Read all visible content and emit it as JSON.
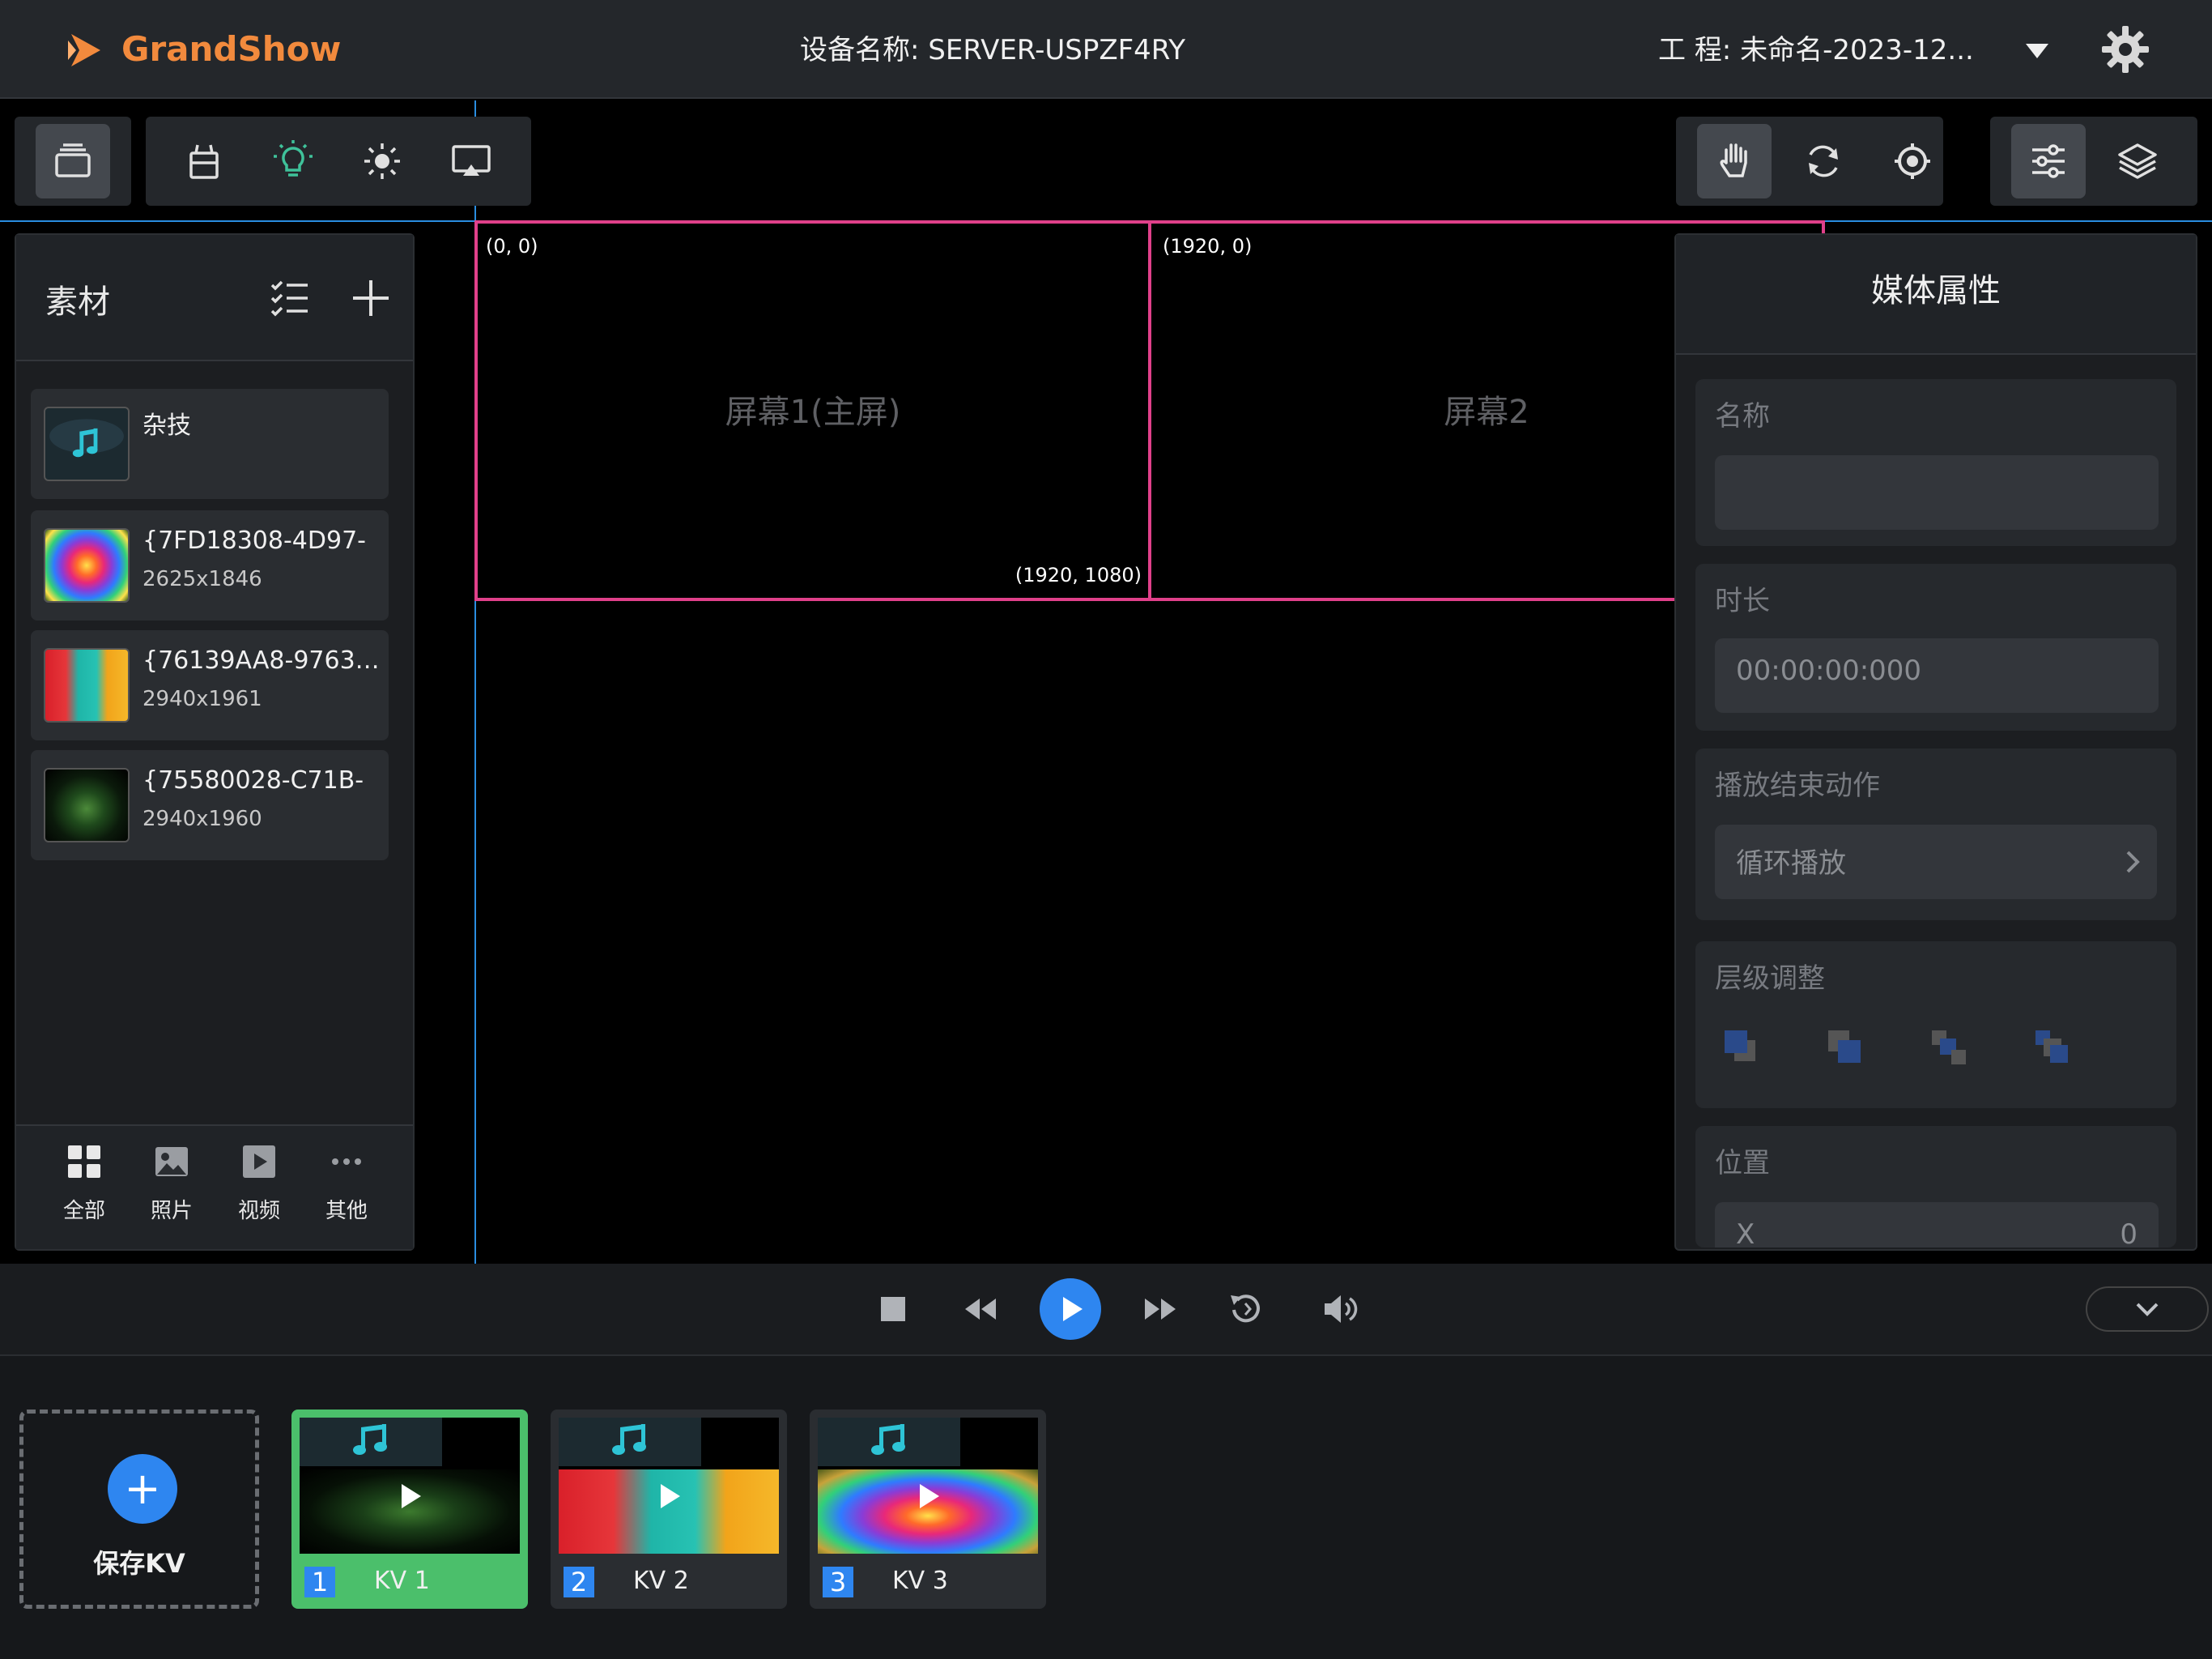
{
  "header": {
    "app_name": "GrandShow",
    "device_label": "设备名称:  SERVER-USPZF4RY",
    "project_label": "工   程:  未命名-2023-12..."
  },
  "toolbar": {
    "left": [
      "layers-icon",
      "stage-icon",
      "bulb-icon",
      "brightness-icon",
      "cast-icon"
    ],
    "right": [
      "hand-icon",
      "refresh-icon",
      "target-icon",
      "sliders-icon",
      "layer-stack-icon"
    ]
  },
  "stage": {
    "screen1": {
      "name": "屏幕1(主屏)",
      "origin": "(0, 0)",
      "corner": "(1920, 1080)"
    },
    "screen2": {
      "name": "屏幕2",
      "origin": "(1920, 0)"
    }
  },
  "assets_panel": {
    "title": "素材",
    "items": [
      {
        "name": "杂技",
        "size": "",
        "thumb": "music"
      },
      {
        "name": "{7FD18308-4D97-",
        "size": "2625x1846",
        "thumb": "rose"
      },
      {
        "name": "{76139AA8-9763-D1...",
        "size": "2940x1961",
        "thumb": "beads"
      },
      {
        "name": "{75580028-C71B-",
        "size": "2940x1960",
        "thumb": "plant"
      }
    ],
    "filters": [
      "全部",
      "照片",
      "视频",
      "其他"
    ]
  },
  "properties_panel": {
    "title": "媒体属性",
    "name_label": "名称",
    "name_value": "",
    "duration_label": "时长",
    "duration_value": "00:00:00:000",
    "end_action_label": "播放结束动作",
    "end_action_value": "循环播放",
    "layer_label": "层级调整",
    "position_label": "位置",
    "position_x_label": "X",
    "position_x_value": "0"
  },
  "kv_bar": {
    "save_label": "保存KV",
    "items": [
      {
        "num": "1",
        "label": "KV 1",
        "active": true
      },
      {
        "num": "2",
        "label": "KV 2",
        "active": false
      },
      {
        "num": "3",
        "label": "KV 3",
        "active": false
      }
    ]
  },
  "colors": {
    "accent": "#2e86f0",
    "brand": "#f28a3d",
    "screen_border": "#e0408a",
    "active_kv": "#4bbf6b"
  }
}
